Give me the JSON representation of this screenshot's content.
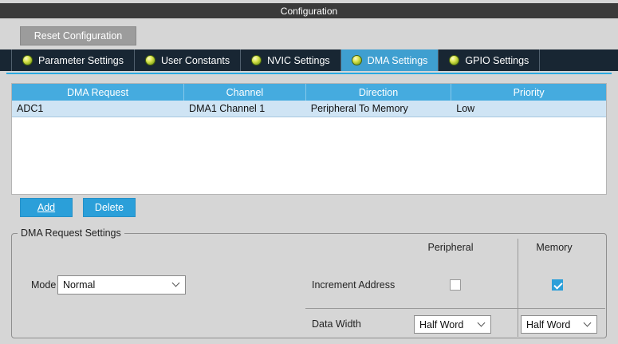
{
  "window": {
    "title": "Configuration"
  },
  "toolbar": {
    "reset_label": "Reset Configuration"
  },
  "tabs": [
    {
      "label": "Parameter Settings",
      "active": false
    },
    {
      "label": "User Constants",
      "active": false
    },
    {
      "label": "NVIC Settings",
      "active": false
    },
    {
      "label": "DMA Settings",
      "active": true
    },
    {
      "label": "GPIO Settings",
      "active": false
    }
  ],
  "table": {
    "headers": [
      "DMA Request",
      "Channel",
      "Direction",
      "Priority"
    ],
    "rows": [
      [
        "ADC1",
        "DMA1 Channel 1",
        "Peripheral To Memory",
        "Low"
      ]
    ]
  },
  "buttons": {
    "add": "Add",
    "delete": "Delete"
  },
  "settings": {
    "group_title": "DMA Request Settings",
    "col_peripheral": "Peripheral",
    "col_memory": "Memory",
    "mode_label": "Mode",
    "mode_value": "Normal",
    "increment_label": "Increment Address",
    "peripheral_increment_checked": false,
    "memory_increment_checked": true,
    "data_width_label": "Data Width",
    "peripheral_data_width": "Half Word",
    "memory_data_width": "Half Word"
  },
  "colors": {
    "page-bg": "#d6d6d6",
    "titlebar-bg": "#3a3a3a",
    "tabbar-bg": "#182633",
    "accent": "#3f9fd0",
    "table-header-bg": "#45abdf",
    "row-selected-bg": "#cfe4f4",
    "button-blue": "#2b9fd9",
    "line-blue": "#2aa9e1"
  }
}
